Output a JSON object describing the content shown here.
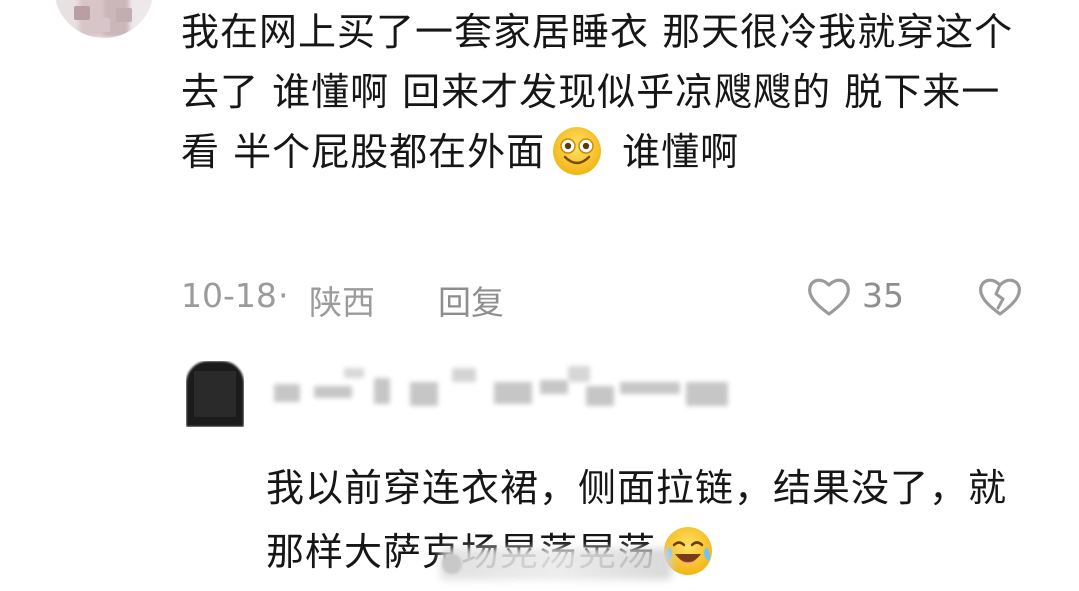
{
  "comment": {
    "text_part1": "我在网上买了一套家居睡衣 那天很冷我就穿这个去了 谁懂啊 回来才发现似乎凉飕飕的 脱下来一看 半个屁股都在外面",
    "text_part2": " 谁懂啊",
    "emoji_icon": "grinning-face-icon",
    "date": "10-18",
    "separator": "·",
    "location": "陕西",
    "reply_label": "回复",
    "like_count": "35",
    "like_icon": "heart-outline-icon",
    "dislike_icon": "broken-heart-icon"
  },
  "reply": {
    "text": "我以前穿连衣裙，侧面拉链，结果没了，就那样大萨克场晃荡晃荡",
    "emoji_icon": "crying-laughing-face-icon"
  },
  "colors": {
    "text": "#161616",
    "meta": "#9b9b9b",
    "emoji_yellow": "#f5c21b"
  }
}
